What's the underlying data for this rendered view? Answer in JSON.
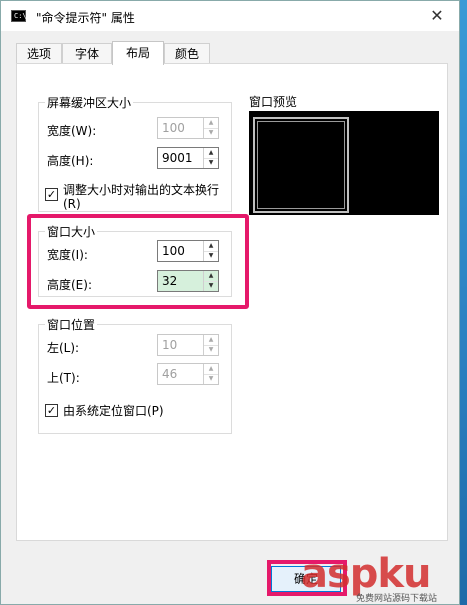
{
  "window": {
    "title": "\"命令提示符\" 属性",
    "icon_text": "C:\\.",
    "close_glyph": "✕"
  },
  "tabs": [
    {
      "label": "选项",
      "active": false
    },
    {
      "label": "字体",
      "active": false
    },
    {
      "label": "布局",
      "active": true
    },
    {
      "label": "颜色",
      "active": false
    }
  ],
  "buffer": {
    "title": "屏幕缓冲区大小",
    "width_label": "宽度(W):",
    "width_value": "100",
    "height_label": "高度(H):",
    "height_value": "9001",
    "wrap_label": "调整大小时对输出的文本换行",
    "wrap_label2": "(R)",
    "wrap_checked": true
  },
  "window_size": {
    "title": "窗口大小",
    "width_label": "宽度(I):",
    "width_value": "100",
    "height_label": "高度(E):",
    "height_value": "32"
  },
  "window_pos": {
    "title": "窗口位置",
    "left_label": "左(L):",
    "left_value": "10",
    "top_label": "上(T):",
    "top_value": "46",
    "system_label": "由系统定位窗口(P)",
    "system_checked": true
  },
  "preview": {
    "title": "窗口预览"
  },
  "ok_button": "确定",
  "watermark": {
    "text": "aspku",
    "sub": "免费网站源码下载站"
  },
  "colors": {
    "highlight": "#e5196a",
    "accent": "#0078d7"
  }
}
